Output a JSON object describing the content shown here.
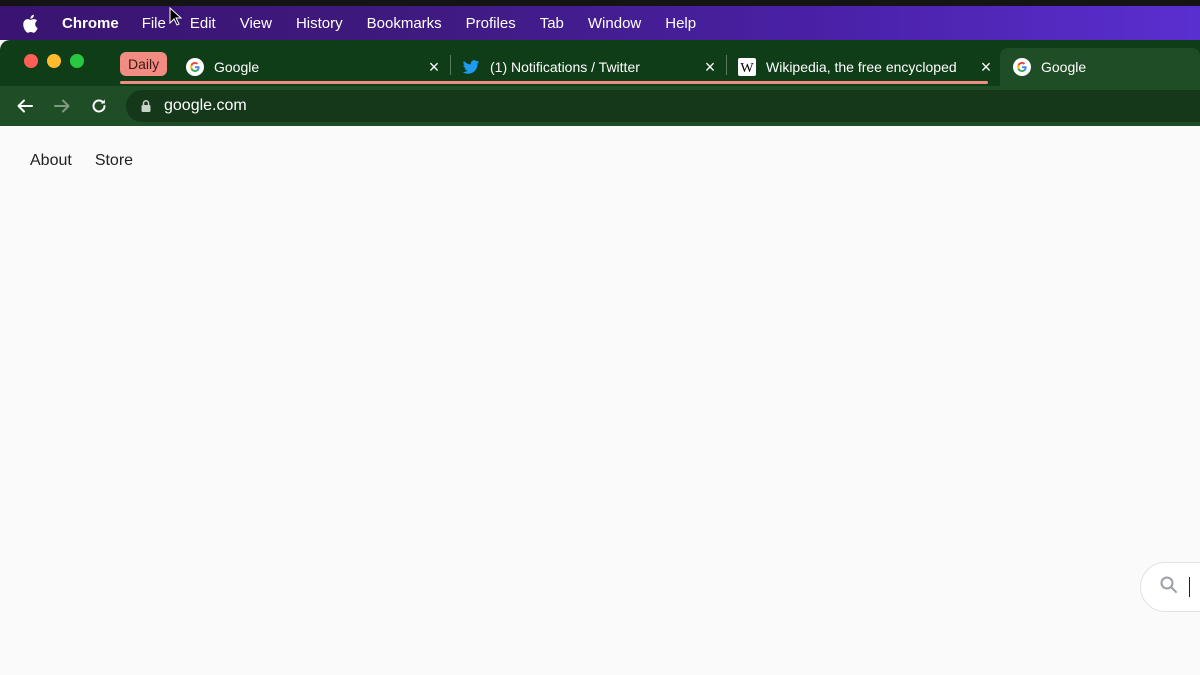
{
  "menubar": {
    "apple_icon": "apple-logo-icon",
    "items": [
      "Chrome",
      "File",
      "Edit",
      "View",
      "History",
      "Bookmarks",
      "Profiles",
      "Tab",
      "Window",
      "Help"
    ]
  },
  "tabstrip": {
    "group_label": "Daily",
    "group_color": "#f28b82",
    "tabs": [
      {
        "title": "Google",
        "favicon": "google-icon",
        "close": "×"
      },
      {
        "title": "(1) Notifications / Twitter",
        "favicon": "twitter-icon",
        "close": "×"
      },
      {
        "title": "Wikipedia, the free encycloped",
        "favicon": "wikipedia-icon",
        "close": "×"
      },
      {
        "title": "Google",
        "favicon": "google-icon",
        "active": true
      }
    ]
  },
  "toolbar": {
    "url": "google.com",
    "back_icon": "back-arrow-icon",
    "forward_icon": "forward-arrow-icon",
    "reload_icon": "reload-icon"
  },
  "page": {
    "links": [
      "About",
      "Store"
    ],
    "search_icon": "search-icon"
  },
  "colors": {
    "menubar_start": "#3a1470",
    "menubar_end": "#5a2fd0",
    "tabstrip_bg": "#0f3d18",
    "toolbar_bg": "#1e4d26",
    "page_bg": "#fafafa"
  }
}
